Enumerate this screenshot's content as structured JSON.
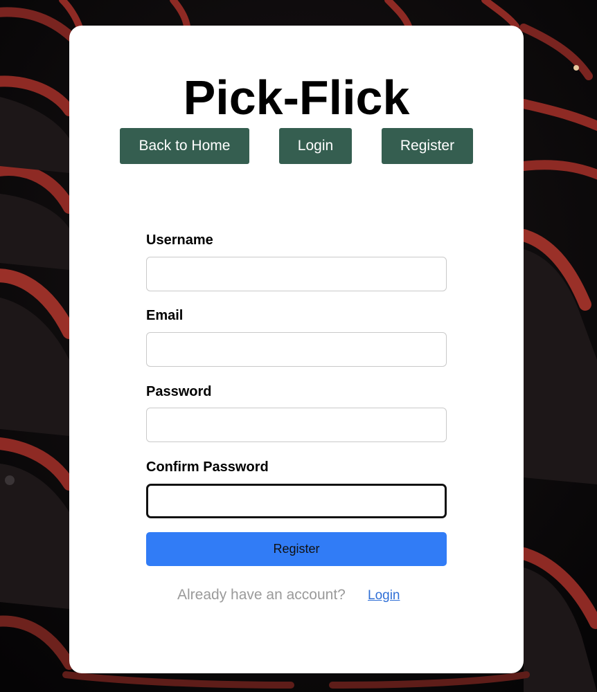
{
  "app": {
    "title": "Pick-Flick"
  },
  "nav": {
    "home_label": "Back to Home",
    "login_label": "Login",
    "register_label": "Register"
  },
  "form": {
    "username": {
      "label": "Username",
      "value": ""
    },
    "email": {
      "label": "Email",
      "value": ""
    },
    "password": {
      "label": "Password",
      "value": ""
    },
    "confirm_password": {
      "label": "Confirm Password",
      "value": ""
    },
    "submit_label": "Register"
  },
  "footer": {
    "prompt": "Already have an account?",
    "link_label": "Login"
  },
  "colors": {
    "nav_button": "#355e50",
    "submit_button": "#317cf6",
    "link": "#2f6fd6",
    "muted_text": "#9a9a9a",
    "seat_red": "#8e2a24"
  },
  "background": {
    "image": "theater-seats-photo"
  }
}
